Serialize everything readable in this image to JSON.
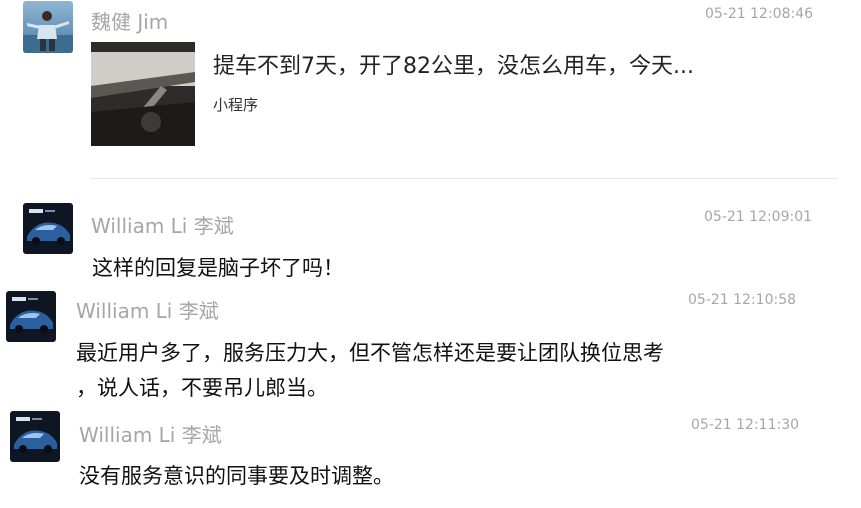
{
  "messages": [
    {
      "sender": "魏健 Jim",
      "time": "05-21 12:08:46",
      "mini_program": {
        "title": "提车不到7天，开了82公里，没怎么用车，今天...",
        "label": "小程序",
        "thumbnail_icon": "car-interior-photo"
      }
    },
    {
      "sender": "William Li 李斌",
      "time": "05-21 12:09:01",
      "text": "这样的回复是脑子坏了吗！"
    },
    {
      "sender": "William Li 李斌",
      "time": "05-21 12:10:58",
      "lines": [
        "最近用户多了，服务压力大，但不管怎样还是要让团队换位思考",
        "，说人话，不要吊儿郎当。"
      ]
    },
    {
      "sender": "William Li 李斌",
      "time": "05-21 12:11:30",
      "text": "没有服务意识的同事要及时调整。"
    }
  ],
  "colors": {
    "meta_text": "#a6a6a6",
    "body_text": "#111111",
    "divider": "#e3e3e3",
    "avatar_car": "#2b5f9e"
  },
  "icons": {
    "jim_avatar": "person-photo-avatar",
    "william_avatar": "nio-car-avatar"
  }
}
